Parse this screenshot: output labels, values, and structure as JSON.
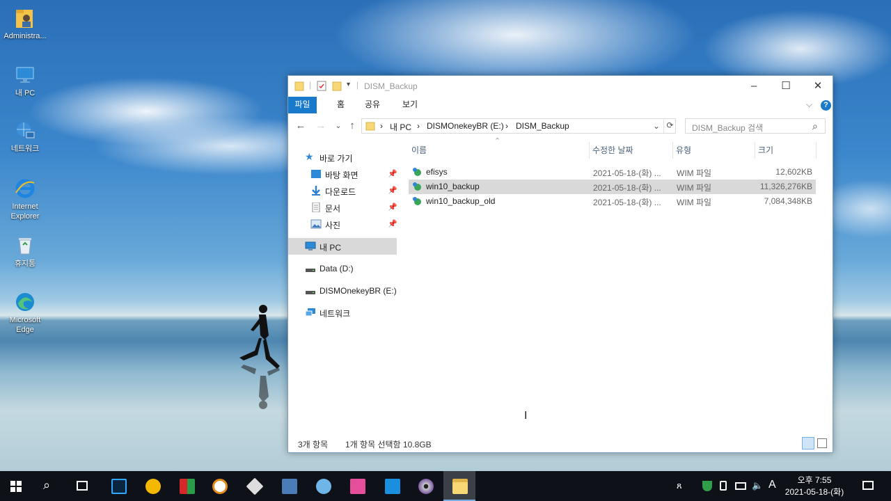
{
  "desktop": {
    "icons": [
      {
        "name": "administrator-folder",
        "label": "Administra..."
      },
      {
        "name": "this-pc",
        "label": "내 PC"
      },
      {
        "name": "network",
        "label": "네트워크"
      },
      {
        "name": "internet-explorer",
        "label": "Internet Explorer"
      },
      {
        "name": "recycle-bin",
        "label": "휴지통"
      },
      {
        "name": "microsoft-edge",
        "label": "Microsoft Edge"
      }
    ]
  },
  "window": {
    "title": "DISM_Backup",
    "controls": {
      "minimize": "–",
      "maximize": "☐",
      "close": "✕"
    }
  },
  "ribbon": {
    "tabs": [
      "파일",
      "홈",
      "공유",
      "보기"
    ],
    "expand": "⌵",
    "help": "?"
  },
  "address": {
    "back": "←",
    "forward": "→",
    "recent": "⌄",
    "up": "↑",
    "path": [
      "내 PC",
      "DISMOnekeyBR (E:)",
      "DISM_Backup"
    ],
    "sep": "›",
    "dropdown": "⌄",
    "refresh": "⟳",
    "search_placeholder": "DISM_Backup 검색",
    "search_icon": "⌕"
  },
  "nav": {
    "quick_access": "바로 가기",
    "quick_items": [
      {
        "label": "바탕 화면"
      },
      {
        "label": "다운로드"
      },
      {
        "label": "문서"
      },
      {
        "label": "사진"
      }
    ],
    "this_pc": "내 PC",
    "drives": [
      {
        "label": "Data (D:)"
      },
      {
        "label": "DISMOnekeyBR (E:)"
      }
    ],
    "network": "네트워크"
  },
  "list": {
    "columns": {
      "name": "이름",
      "date": "수정한 날짜",
      "type": "유형",
      "size": "크기"
    },
    "sort_indicator": "⌃",
    "files": [
      {
        "name": "efisys",
        "date": "2021-05-18-(화) ...",
        "type": "WIM 파일",
        "size": "12,602KB",
        "selected": false
      },
      {
        "name": "win10_backup",
        "date": "2021-05-18-(화) ...",
        "type": "WIM 파일",
        "size": "11,326,276KB",
        "selected": true
      },
      {
        "name": "win10_backup_old",
        "date": "2021-05-18-(화) ...",
        "type": "WIM 파일",
        "size": "7,084,348KB",
        "selected": false
      }
    ]
  },
  "status": {
    "count": "3개 항목",
    "selected": "1개 항목 선택함 10.8GB"
  },
  "taskbar": {
    "clock_time": "오후 7:55",
    "clock_date": "2021-05-18-(화)",
    "ime": "A",
    "people_icon": "ጸ"
  },
  "colors": {
    "accent": "#1979ca",
    "selection": "#d9d9d9",
    "folder": "#f8d775"
  }
}
